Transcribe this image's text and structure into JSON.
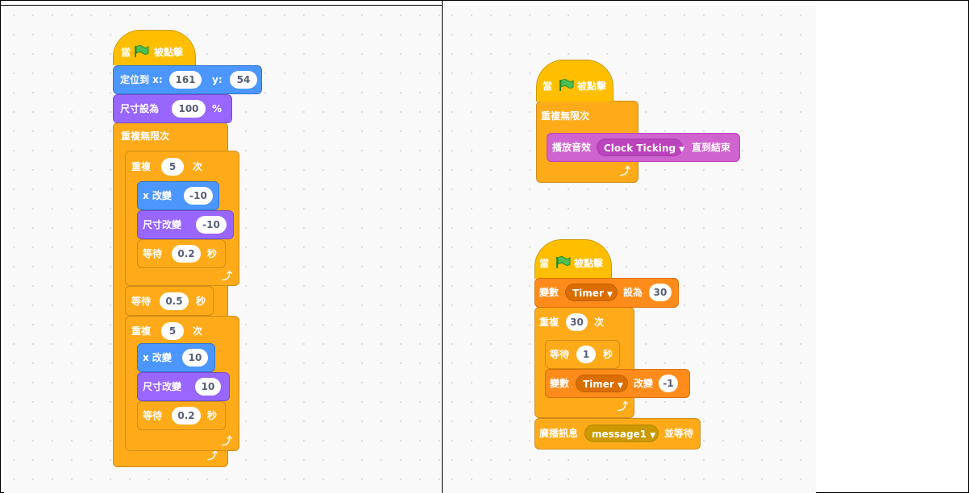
{
  "left_script": {
    "hat": {
      "prefix": "當",
      "suffix": "被點擊"
    },
    "goto": {
      "label": "定位到 x:",
      "x": "161",
      "y_label": "y:",
      "y": "54"
    },
    "set_size": {
      "label": "尺寸設為",
      "value": "100",
      "unit": "%"
    },
    "forever": {
      "label": "重複無限次"
    },
    "repeat1": {
      "label": "重複",
      "count": "5",
      "unit": "次"
    },
    "change_x1": {
      "label": "x 改變",
      "value": "-10"
    },
    "change_size1": {
      "label": "尺寸改變",
      "value": "-10"
    },
    "wait1": {
      "label": "等待",
      "value": "0.2",
      "unit": "秒"
    },
    "wait_mid": {
      "label": "等待",
      "value": "0.5",
      "unit": "秒"
    },
    "repeat2": {
      "label": "重複",
      "count": "5",
      "unit": "次"
    },
    "change_x2": {
      "label": "x 改變",
      "value": "10"
    },
    "change_size2": {
      "label": "尺寸改變",
      "value": "10"
    },
    "wait2": {
      "label": "等待",
      "value": "0.2",
      "unit": "秒"
    }
  },
  "right_script_top": {
    "hat": {
      "prefix": "當",
      "suffix": "被點擊"
    },
    "forever": {
      "label": "重複無限次"
    },
    "play_sound": {
      "label": "播放音效",
      "sound": "Clock Ticking",
      "suffix": "直到結束"
    }
  },
  "right_script_bottom": {
    "hat": {
      "prefix": "當",
      "suffix": "被點擊"
    },
    "set_var": {
      "label": "變數",
      "var": "Timer",
      "mid": "設為",
      "value": "30"
    },
    "repeat": {
      "label": "重複",
      "count": "30",
      "unit": "次"
    },
    "wait": {
      "label": "等待",
      "value": "1",
      "unit": "秒"
    },
    "change_var": {
      "label": "變數",
      "var": "Timer",
      "mid": "改變",
      "value": "-1"
    },
    "broadcast": {
      "label": "廣播訊息",
      "message": "message1",
      "suffix": "並等待"
    }
  },
  "icons": {
    "flag": "green-flag-icon",
    "dropdown": "dropdown-arrow-icon",
    "loop": "loop-arrow-icon"
  },
  "colors": {
    "motion": "#4C97FF",
    "looks": "#9966FF",
    "sound": "#CF63CF",
    "control": "#FFAB19",
    "events": "#FFBF00",
    "variables": "#FF8C1A"
  }
}
